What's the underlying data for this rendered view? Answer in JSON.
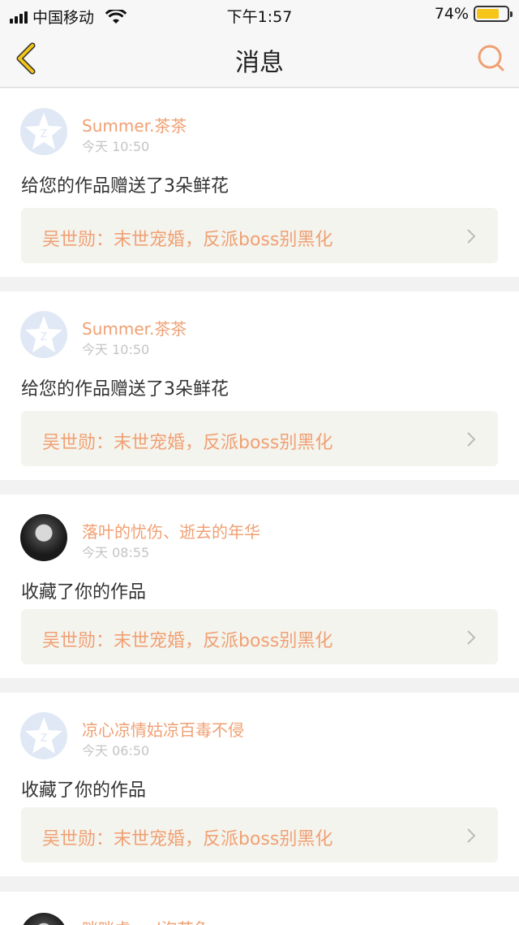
{
  "status_bar": {
    "carrier": "中国移动",
    "time": "下午1:57",
    "battery": "74%",
    "battery_level": 0.74,
    "battery_color": "#f5c518"
  },
  "nav": {
    "title": "消息",
    "back_icon": "chevron-left-icon",
    "search_icon": "search-icon"
  },
  "colors": {
    "accent": "#f0a073",
    "back": "#f0c419"
  },
  "messages": [
    {
      "user": "Summer.茶茶",
      "time": "今天 10:50",
      "text": "给您的作品赠送了3朵鲜花",
      "work": "吴世勋：末世宠婚，反派boss别黑化",
      "avatar": "default"
    },
    {
      "user": "Summer.茶茶",
      "time": "今天 10:50",
      "text": "给您的作品赠送了3朵鲜花",
      "work": "吴世勋：末世宠婚，反派boss别黑化",
      "avatar": "default"
    },
    {
      "user": "落叶的忧伤、逝去的年华",
      "time": "今天 08:55",
      "text": "收藏了你的作品",
      "work": "吴世勋：末世宠婚，反派boss别黑化",
      "avatar": "photo"
    },
    {
      "user": "凉心凉情姑凉百毒不侵",
      "time": "今天 06:50",
      "text": "收藏了你的作品",
      "work": "吴世勋：末世宠婚，反派boss别黑化",
      "avatar": "default"
    }
  ],
  "partial_item": {
    "user": "咣咣虎and泡芙兔"
  }
}
